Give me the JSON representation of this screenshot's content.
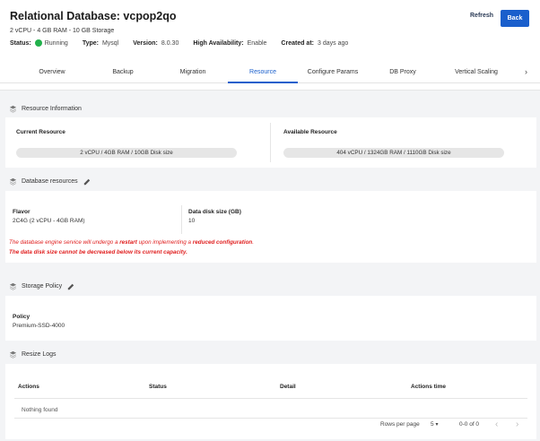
{
  "header": {
    "title": "Relational Database: vcpop2qo",
    "subtitle": "2 vCPU - 4 GB RAM - 10 GB Storage",
    "status_label": "Status:",
    "status_value": "Running",
    "type_label": "Type:",
    "type_value": "Mysql",
    "version_label": "Version:",
    "version_value": "8.0.30",
    "ha_label": "High Availability:",
    "ha_value": "Enable",
    "created_label": "Created at:",
    "created_value": "3 days ago",
    "refresh_label": "Refresh",
    "back_label": "Back"
  },
  "tabs": [
    {
      "label": "Overview"
    },
    {
      "label": "Backup"
    },
    {
      "label": "Migration"
    },
    {
      "label": "Resource"
    },
    {
      "label": "Configure Params"
    },
    {
      "label": "DB Proxy"
    },
    {
      "label": "Vertical Scaling"
    }
  ],
  "active_tab": "Resource",
  "resource_info": {
    "title": "Resource Information",
    "current_label": "Current Resource",
    "current_value": "2 vCPU / 4GB RAM / 10GB Disk size",
    "available_label": "Available Resource",
    "available_value": "404 vCPU / 1324GB RAM / 1110GB Disk size"
  },
  "db_resources": {
    "title": "Database resources",
    "flavor_label": "Flavor",
    "flavor_value": "2C4G (2 vCPU - 4GB RAM)",
    "disk_label": "Data disk size (GB)",
    "disk_value": "10",
    "warning1_a": "The database engine service will undergo a ",
    "warning1_b": "restart",
    "warning1_c": " upon implementing a ",
    "warning1_d": "reduced configuration",
    "warning1_e": ".",
    "warning2": "The data disk size cannot be decreased below its current capacity."
  },
  "storage_policy": {
    "title": "Storage Policy",
    "policy_label": "Policy",
    "policy_value": "Premium-SSD-4000"
  },
  "resize_logs": {
    "title": "Resize Logs",
    "columns": [
      "Actions",
      "Status",
      "Detail",
      "Actions time"
    ],
    "empty_text": "Nothing found",
    "rows_per_page_label": "Rows per page",
    "rows_per_page_value": "5",
    "range_text": "0-0 of 0"
  },
  "colors": {
    "accent": "#1a5fcc",
    "status_green": "#22b14c",
    "warning_red": "#e02020"
  }
}
